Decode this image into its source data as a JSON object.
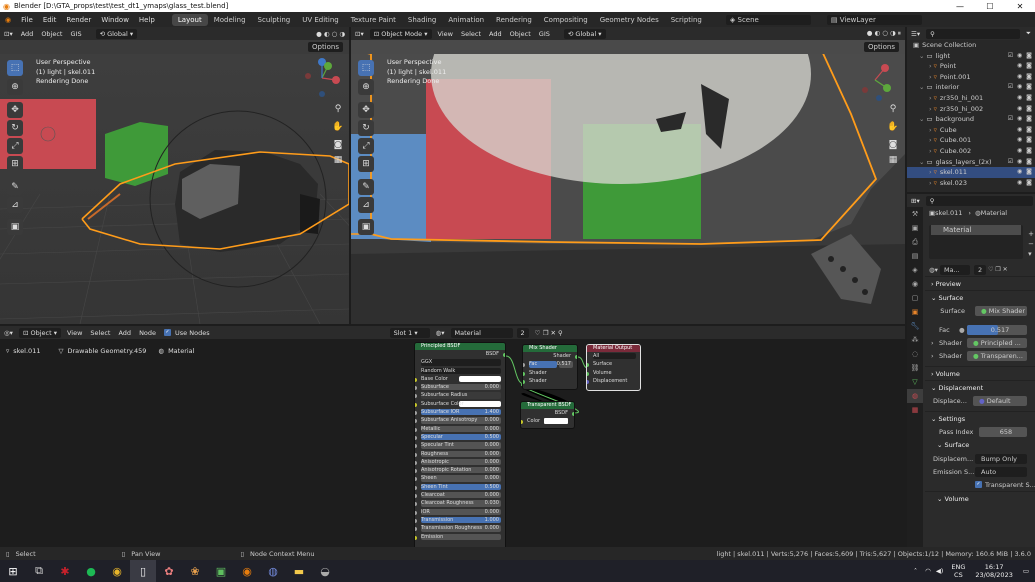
{
  "titlebar": {
    "title": "Blender [D:\\GTA_props\\test\\test_dt1_ymaps\\glass_test.blend]",
    "minimize": "—",
    "maximize": "☐",
    "close": "✕"
  },
  "menu": [
    "File",
    "Edit",
    "Render",
    "Window",
    "Help"
  ],
  "workspaces": [
    "Layout",
    "Modeling",
    "Sculpting",
    "UV Editing",
    "Texture Paint",
    "Shading",
    "Animation",
    "Rendering",
    "Compositing",
    "Geometry Nodes",
    "Scripting"
  ],
  "scene": {
    "scene_label": "Scene",
    "viewlayer_label": "ViewLayer"
  },
  "vp1": {
    "header": [
      "Add",
      "Object",
      "GIS"
    ],
    "orientation": "Global",
    "options": "Options",
    "ovl": [
      "User Perspective",
      "(1) light | skel.011",
      "Rendering Done"
    ]
  },
  "vp2": {
    "mode": "Object Mode",
    "header": [
      "View",
      "Select",
      "Add",
      "Object",
      "GIS"
    ],
    "orientation": "Global",
    "options": "Options",
    "ovl": [
      "User Perspective",
      "(1) light | skel.011",
      "Rendering Done"
    ]
  },
  "node_editor": {
    "editor_type": "Object",
    "menu": [
      "View",
      "Select",
      "Add",
      "Node"
    ],
    "use_nodes": "Use Nodes",
    "slot": "Slot 1",
    "material": "Material",
    "users": "2",
    "breadcrumb": [
      "skel.011",
      "Drawable Geometry.459",
      "Material"
    ]
  },
  "principled": {
    "title": "Principled BSDF",
    "out": "BSDF",
    "dist": "GGX",
    "sss": "Random Walk",
    "rows": [
      [
        "Base Color",
        ""
      ],
      [
        "Subsurface",
        "0.000"
      ],
      [
        "Subsurface Radius",
        ""
      ],
      [
        "Subsurface Color",
        ""
      ],
      [
        "Subsurface IOR",
        "1.400"
      ],
      [
        "Subsurface Anisotropy",
        "0.000"
      ],
      [
        "Metallic",
        "0.000"
      ],
      [
        "Specular",
        "0.500"
      ],
      [
        "Specular Tint",
        "0.000"
      ],
      [
        "Roughness",
        "0.000"
      ],
      [
        "Anisotropic",
        "0.000"
      ],
      [
        "Anisotropic Rotation",
        "0.000"
      ],
      [
        "Sheen",
        "0.000"
      ],
      [
        "Sheen Tint",
        "0.500"
      ],
      [
        "Clearcoat",
        "0.000"
      ],
      [
        "Clearcoat Roughness",
        "0.030"
      ],
      [
        "IOR",
        "0.000"
      ],
      [
        "Transmission",
        "1.000"
      ],
      [
        "Transmission Roughness",
        "0.000"
      ],
      [
        "Emission",
        ""
      ]
    ]
  },
  "mix": {
    "title": "Mix Shader",
    "out": "Shader",
    "fac_label": "Fac",
    "fac": "0.517",
    "in1": "Shader",
    "in2": "Shader"
  },
  "output": {
    "title": "Material Output",
    "target": "All",
    "s": "Surface",
    "v": "Volume",
    "d": "Displacement"
  },
  "transparent": {
    "title": "Transparent BSDF",
    "out": "BSDF",
    "color": "Color"
  },
  "outliner": {
    "title": "Scene Collection",
    "rows": [
      {
        "label": "light",
        "ind": 1
      },
      {
        "label": "Point",
        "ind": 2
      },
      {
        "label": "Point.001",
        "ind": 2
      },
      {
        "label": "interior",
        "ind": 1
      },
      {
        "label": "zr350_hi_001",
        "ind": 2
      },
      {
        "label": "zr350_hi_002",
        "ind": 2
      },
      {
        "label": "background",
        "ind": 1
      },
      {
        "label": "Cube",
        "ind": 2
      },
      {
        "label": "Cube.001",
        "ind": 2
      },
      {
        "label": "Cube.002",
        "ind": 2
      },
      {
        "label": "glass_layers_(2x)",
        "ind": 1
      },
      {
        "label": "skel.011",
        "ind": 2,
        "sel": true
      },
      {
        "label": "skel.023",
        "ind": 2
      }
    ]
  },
  "props": {
    "obj": "skel.011",
    "mat_tab": "Material",
    "slot_item": "Material",
    "mat_name": "Ma...",
    "users": "2",
    "preview": "Preview",
    "surface_sec": "Surface",
    "surface_label": "Surface",
    "surface_val": "Mix Shader",
    "fac_label": "Fac",
    "fac_val": "0.517",
    "shader_label": "Shader",
    "shader1": "Principled ...",
    "shader2": "Transparen...",
    "volume": "Volume",
    "displacement_sec": "Displacement",
    "displace_label": "Displace...",
    "displace_val": "Default",
    "settings": "Settings",
    "pass_label": "Pass Index",
    "pass_val": "658",
    "surface_sub": "Surface",
    "dispm_label": "Displacem...",
    "dispm_val": "Bump Only",
    "emis_label": "Emission S...",
    "emis_val": "Auto",
    "transp": "Transparent S...",
    "volume2": "Volume"
  },
  "status": {
    "select": "Select",
    "pan": "Pan View",
    "ctx": "Node Context Menu",
    "stats": "light | skel.011 | Verts:5,276 | Faces:5,609 | Tris:5,627 | Objects:1/12 | Memory: 160.6 MiB | 3.6.0"
  },
  "taskbar": {
    "lang": "ENG",
    "region": "CS",
    "time": "16:17",
    "date": "23/08/2023"
  },
  "colors": {
    "accent": "#4772b3",
    "orange": "#ff9c1a",
    "red": "#c84a52",
    "green": "#3f9a39",
    "blue": "#5c8cc2"
  }
}
